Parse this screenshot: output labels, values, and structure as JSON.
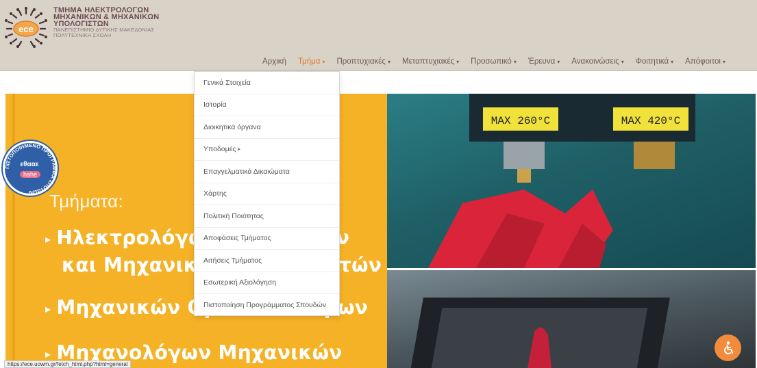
{
  "header": {
    "org_lines": [
      "ΤΜΗΜΑ ΗΛΕΚΤΡΟΛΟΓΩΝ",
      "ΜΗΧΑΝΙΚΩΝ & ΜΗΧΑΝΙΚΩΝ",
      "ΥΠΟΛΟΓΙΣΤΩΝ"
    ],
    "sub_lines": [
      "ΠΑΝΕΠΙΣΤΗΜΙΟ ΔΥΤΙΚΗΣ ΜΑΚΕΔΟΝΙΑΣ",
      "ΠΟΛΥΤΕΧΝΙΚΗ ΣΧΟΛΗ"
    ],
    "logo_text": "ece",
    "brand_color": "#6b4a52"
  },
  "nav": {
    "items": [
      {
        "label": "Αρχική",
        "caret": ""
      },
      {
        "label": "Τμήμα",
        "caret": "▾"
      },
      {
        "label": "Προπτυχιακές",
        "caret": "▾"
      },
      {
        "label": "Μεταπτυχιακές",
        "caret": "▾"
      },
      {
        "label": "Προσωπικό",
        "caret": "▾"
      },
      {
        "label": "Έρευνα",
        "caret": "▾"
      },
      {
        "label": "Ανακοινώσεις",
        "caret": "▾"
      },
      {
        "label": "Φοιτητικά",
        "caret": "▾"
      },
      {
        "label": "Απόφοιτοι",
        "caret": "▾"
      }
    ],
    "active_color": "#e07a2c"
  },
  "dropdown": {
    "items": [
      {
        "label": "Γενικά Στοιχεία",
        "caret": ""
      },
      {
        "label": "Ιστορία",
        "caret": ""
      },
      {
        "label": "Διοικητικά όργανα",
        "caret": ""
      },
      {
        "label": "Υποδομές",
        "caret": "▸"
      },
      {
        "label": "Επαγγελματικά Δικαιώματα",
        "caret": ""
      },
      {
        "label": "Χάρτης",
        "caret": ""
      },
      {
        "label": "Πολιτική Ποιότητας",
        "caret": ""
      },
      {
        "label": "Αποφάσεις Τμήματος",
        "caret": ""
      },
      {
        "label": "Αιτήσεις Τμήματος",
        "caret": ""
      },
      {
        "label": "Εσωτερική Αξιολόγηση",
        "caret": ""
      },
      {
        "label": "Πιστοποίηση Προγράμματος Σπουδών",
        "caret": ""
      }
    ]
  },
  "hero": {
    "title": "Τμήματα:",
    "depts": [
      {
        "arrow": "▸",
        "text": "Ηλεκτρολόγων Μηχανικών"
      },
      {
        "arrow": "",
        "text": "και Μηχανικών Υπολογιστών"
      },
      {
        "arrow": "▸",
        "text": "Μηχανικών Ορυκτών Πόρων"
      },
      {
        "arrow": "▸",
        "text": "Μηχανολόγων Μηχανικών"
      }
    ],
    "labels": [
      "MAX 260°C",
      "MAX 420°C"
    ],
    "accent_color": "#f5b226"
  },
  "badge": {
    "arc_text": "ΠΙΣΤΟΠΟΙΗΜΕΝΟ ΠΡΟΓΡΑΜΜΑ ΣΠΟΥΔΩΝ",
    "name": "εθααε",
    "sub": "hahe"
  },
  "status_url": "https://ece.uowm.gr/fetch_html.php?html=general"
}
